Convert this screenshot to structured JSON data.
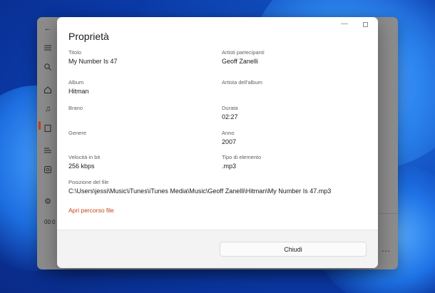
{
  "dialog": {
    "title": "Proprietà",
    "fields": [
      {
        "label": "Titolo",
        "value": "My Number Is 47"
      },
      {
        "label": "Artisti partecipanti",
        "value": "Geoff Zanelli"
      },
      {
        "label": "Album",
        "value": "Hitman"
      },
      {
        "label": "Artista dell'album",
        "value": ""
      },
      {
        "label": "Brano",
        "value": ""
      },
      {
        "label": "Durata",
        "value": "02:27"
      },
      {
        "label": "Genere",
        "value": ""
      },
      {
        "label": "Anno",
        "value": "2007"
      },
      {
        "label": "Velocità in bit",
        "value": "256 kbps"
      },
      {
        "label": "Tipo di elemento",
        "value": ".mp3"
      }
    ],
    "file_location": {
      "label": "Posizione del file",
      "value": "C:\\Users\\jessi\\Music\\iTunes\\iTunes Media\\Music\\Geoff Zanelli\\Hitman\\My Number Is 47.mp3"
    },
    "open_path_link": "Apri percorso file",
    "close_button": "Chiudi",
    "accent_color": "#c4411c"
  },
  "player": {
    "time": "00:0",
    "more_label": "...",
    "icons": [
      "back-arrow-icon",
      "hamburger-menu-icon",
      "search-icon",
      "home-icon",
      "music-library-icon",
      "video-library-icon",
      "playlist-icon",
      "play-queue-icon",
      "settings-icon"
    ]
  }
}
